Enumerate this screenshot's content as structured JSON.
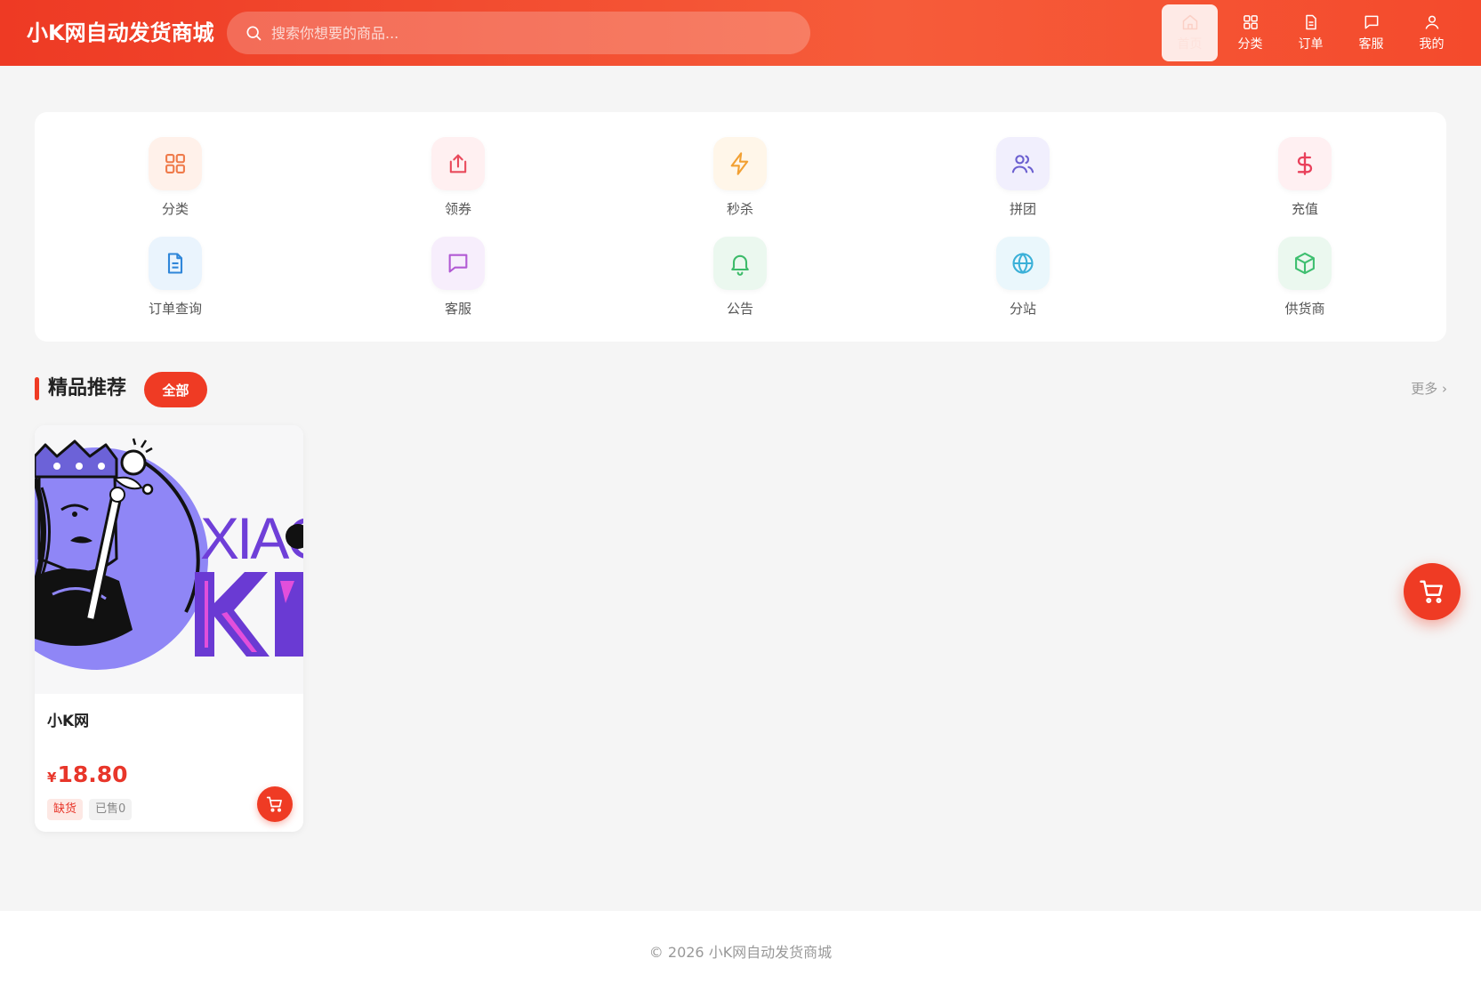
{
  "header": {
    "logo": "小K网自动发货商城",
    "search_placeholder": "搜索你想要的商品...",
    "nav": [
      {
        "label": "首页",
        "icon": "home-icon",
        "active": true
      },
      {
        "label": "分类",
        "icon": "grid-icon",
        "active": false
      },
      {
        "label": "订单",
        "icon": "document-icon",
        "active": false
      },
      {
        "label": "客服",
        "icon": "chat-icon",
        "active": false
      },
      {
        "label": "我的",
        "icon": "user-icon",
        "active": false
      }
    ]
  },
  "quick_menu": [
    {
      "label": "分类",
      "icon": "grid-icon",
      "color": "#ef7a4a",
      "bg": "#fff1ea"
    },
    {
      "label": "领券",
      "icon": "coupon-icon",
      "color": "#e94a5c",
      "bg": "#fff0f1"
    },
    {
      "label": "秒杀",
      "icon": "lightning-icon",
      "color": "#f2a033",
      "bg": "#fff6e9"
    },
    {
      "label": "拼团",
      "icon": "users-icon",
      "color": "#6b5fd0",
      "bg": "#f1effd"
    },
    {
      "label": "充值",
      "icon": "dollar-icon",
      "color": "#e9405b",
      "bg": "#fff0f2"
    },
    {
      "label": "订单查询",
      "icon": "file-text-icon",
      "color": "#2f86d9",
      "bg": "#eaf4fd"
    },
    {
      "label": "客服",
      "icon": "message-icon",
      "color": "#b25ad4",
      "bg": "#f7eefc"
    },
    {
      "label": "公告",
      "icon": "bell-icon",
      "color": "#3dbb6a",
      "bg": "#ebf8ef"
    },
    {
      "label": "分站",
      "icon": "globe-icon",
      "color": "#3bb0d8",
      "bg": "#eaf7fc"
    },
    {
      "label": "供货商",
      "icon": "box-icon",
      "color": "#3fbf70",
      "bg": "#ebf8ef"
    }
  ],
  "section": {
    "title": "精品推荐",
    "all_label": "全部",
    "more_label": "更多 ›"
  },
  "products": [
    {
      "name": "小K网",
      "price_symbol": "¥",
      "price": "18.80",
      "stock_tag": "缺货",
      "sold_tag": "已售0",
      "image_text": "XIAO"
    }
  ],
  "footer": {
    "copyright": "© 2026 小K网自动发货商城"
  },
  "colors": {
    "brand": "#ef3b24",
    "price": "#e8362a"
  }
}
